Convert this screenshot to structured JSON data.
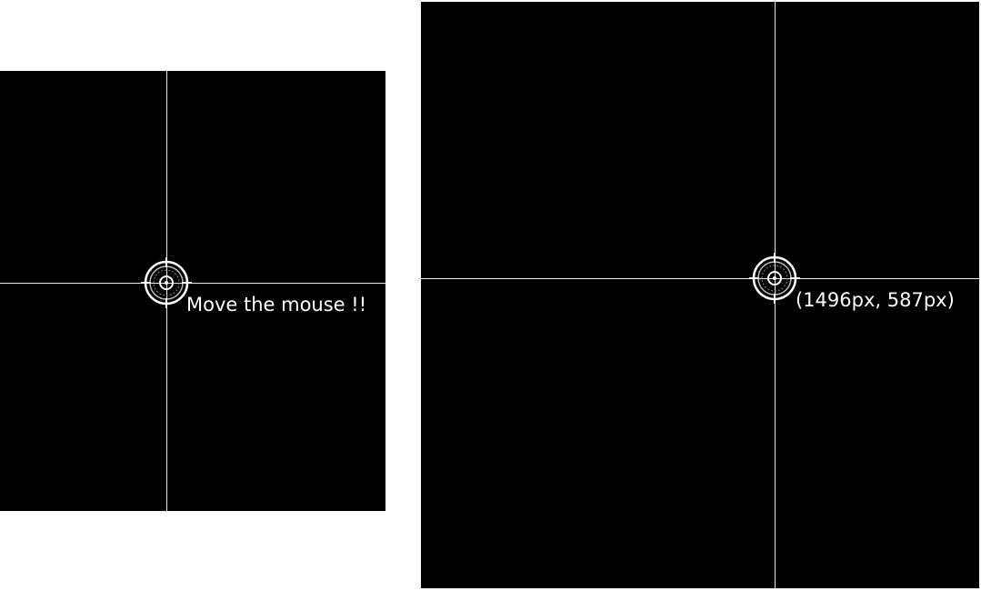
{
  "left_panel": {
    "label": "Move the mouse !!",
    "crosshair_icon": "crosshair-target-icon"
  },
  "right_panel": {
    "label": "(1496px, 587px)",
    "crosshair_icon": "crosshair-target-icon"
  },
  "colors": {
    "panel_background": "#000000",
    "page_background": "#ffffff",
    "line_color": "#e8e8e8",
    "text_color": "#ffffff"
  }
}
